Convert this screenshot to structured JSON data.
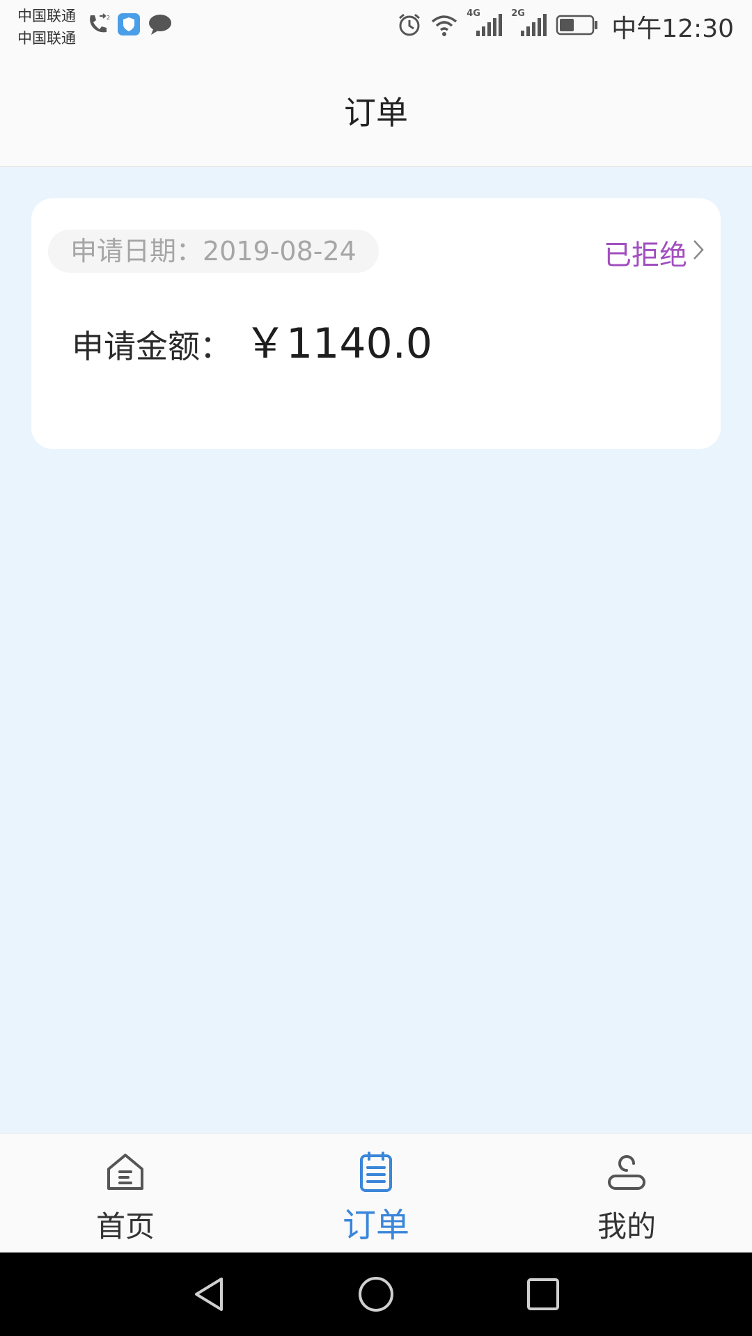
{
  "status_bar": {
    "carrier_1": "中国联通",
    "carrier_2": "中国联通",
    "time": "中午12:30",
    "network_1": "4G",
    "network_2": "2G",
    "left_icons": [
      "call-forward-icon",
      "shield-app-icon",
      "chat-bubble-icon"
    ],
    "right_icons": [
      "alarm-icon",
      "wifi-icon",
      "signal-4g-icon",
      "signal-2g-icon",
      "battery-icon"
    ],
    "battery_level": 0.45
  },
  "header": {
    "title": "订单"
  },
  "order": {
    "date_text": "申请日期：2019-08-24",
    "status": "已拒绝",
    "amount_label": "申请金额：",
    "amount_value": "￥1140.0"
  },
  "tab_bar": {
    "tabs": [
      {
        "label": "首页",
        "icon": "home-icon",
        "active": false
      },
      {
        "label": "订单",
        "icon": "order-list-icon",
        "active": true
      },
      {
        "label": "我的",
        "icon": "profile-icon",
        "active": false
      }
    ]
  },
  "system_nav": {
    "buttons": [
      "back-icon",
      "home-circle-icon",
      "recents-icon"
    ]
  },
  "colors": {
    "background": "#eaf4fd",
    "accent": "#3a86d9",
    "status_rejected": "#a24ebf",
    "card": "#ffffff"
  }
}
